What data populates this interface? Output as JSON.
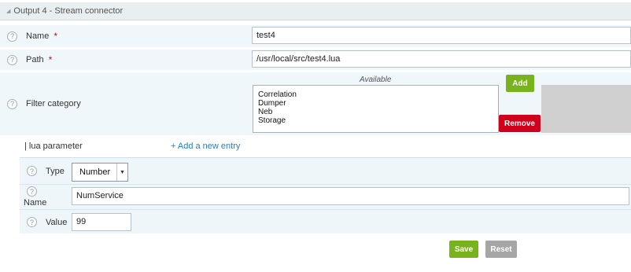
{
  "section": {
    "title": "Output 4 - Stream connector"
  },
  "fields": {
    "name": {
      "label": "Name",
      "required_mark": "*",
      "value": "test4"
    },
    "path": {
      "label": "Path",
      "required_mark": "*",
      "value": "/usr/local/src/test4.lua"
    },
    "filter_category": {
      "label": "Filter category",
      "available_title": "Available",
      "available_items": [
        "Correlation",
        "Dumper",
        "Neb",
        "Storage"
      ],
      "add_label": "Add",
      "remove_label": "Remove"
    }
  },
  "lua_parameter": {
    "label": "| lua parameter",
    "add_entry_label": "+ Add a new entry",
    "type": {
      "label": "Type",
      "value": "Number"
    },
    "name": {
      "label": "Name",
      "value": "NumService"
    },
    "value": {
      "label": "Value",
      "value": "99"
    }
  },
  "help_glyph": "?",
  "dropdown_glyph": "▼",
  "collapse_glyph": "◢",
  "actions": {
    "save_label": "Save",
    "reset_label": "Reset"
  },
  "colors": {
    "add_green": "#78b21d",
    "remove_red": "#d0021b",
    "reset_gray": "#a6a6a6",
    "link_blue": "#2a7fc0"
  }
}
